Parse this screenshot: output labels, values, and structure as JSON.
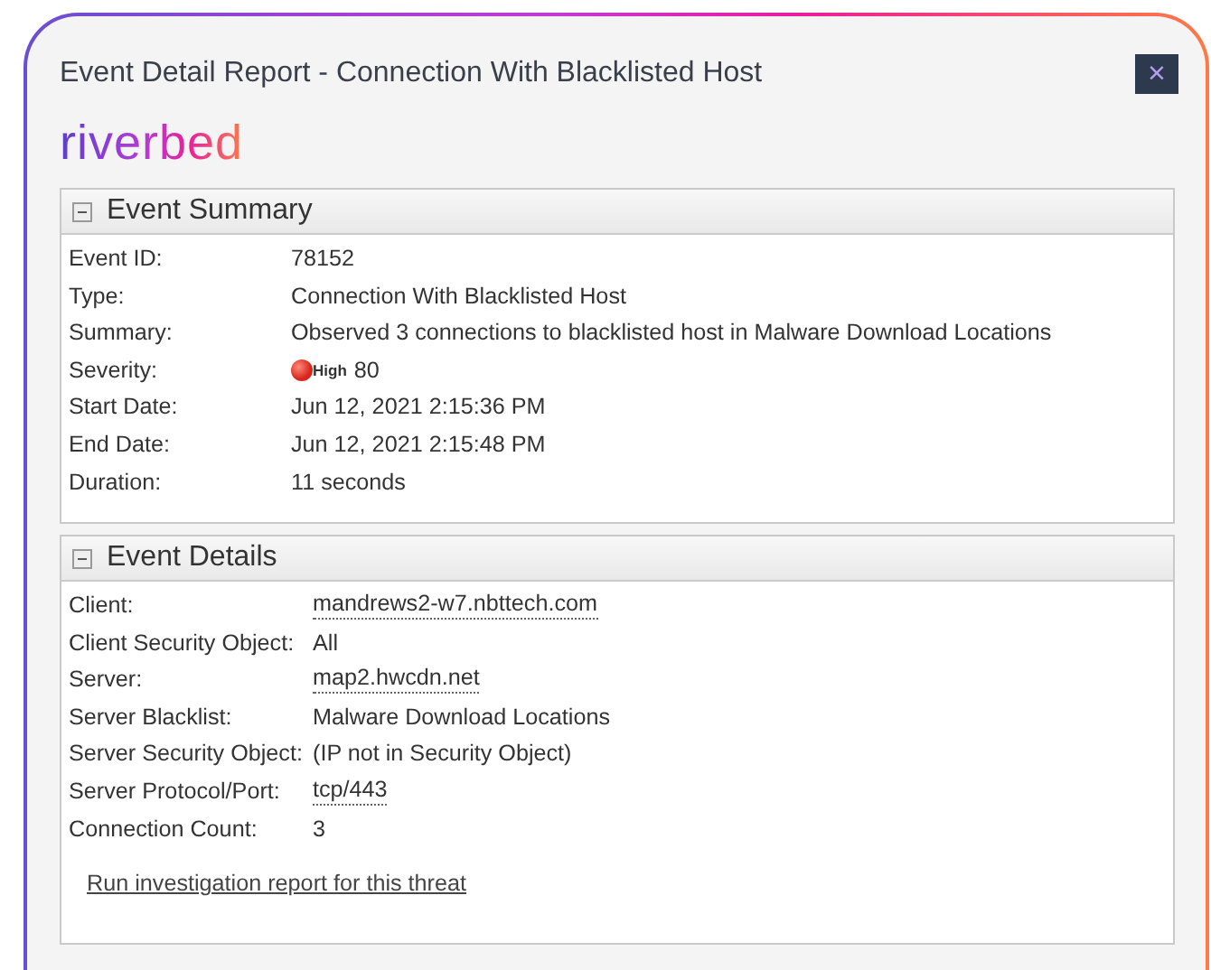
{
  "window": {
    "title": "Event Detail Report - Connection With Blacklisted Host",
    "close": "×"
  },
  "logo": "riverbed",
  "sections": [
    {
      "title": "Event Summary",
      "expanded": true,
      "rows": [
        {
          "label": "Event ID:",
          "value": "78152",
          "kind": "text"
        },
        {
          "label": "Type:",
          "value": "Connection With Blacklisted Host",
          "kind": "text"
        },
        {
          "label": "Summary:",
          "value": "Observed 3 connections to blacklisted host in Malware Download Locations",
          "kind": "text"
        },
        {
          "label": "Severity:",
          "value": "80",
          "kind": "severity",
          "severity_label": "High",
          "color": "#d9261c"
        },
        {
          "label": "Start Date:",
          "value": "Jun 12, 2021 2:15:36 PM",
          "kind": "text"
        },
        {
          "label": "End Date:",
          "value": "Jun 12, 2021 2:15:48 PM",
          "kind": "text"
        },
        {
          "label": "Duration:",
          "value": "11 seconds",
          "kind": "text"
        }
      ]
    },
    {
      "title": "Event Details",
      "expanded": true,
      "rows": [
        {
          "label": "Client:",
          "value": "mandrews2-w7.nbttech.com",
          "kind": "link"
        },
        {
          "label": "Client Security Object:",
          "value": "All",
          "kind": "text"
        },
        {
          "label": "Server:",
          "value": "map2.hwcdn.net",
          "kind": "link"
        },
        {
          "label": "Server Blacklist:",
          "value": "Malware Download Locations",
          "kind": "text"
        },
        {
          "label": "Server Security Object:",
          "value": "(IP not in Security Object)",
          "kind": "text"
        },
        {
          "label": "Server Protocol/Port:",
          "value": "tcp/443",
          "kind": "link"
        },
        {
          "label": "Connection Count:",
          "value": "3",
          "kind": "text"
        }
      ],
      "action_link": "Run investigation report for this threat"
    }
  ]
}
